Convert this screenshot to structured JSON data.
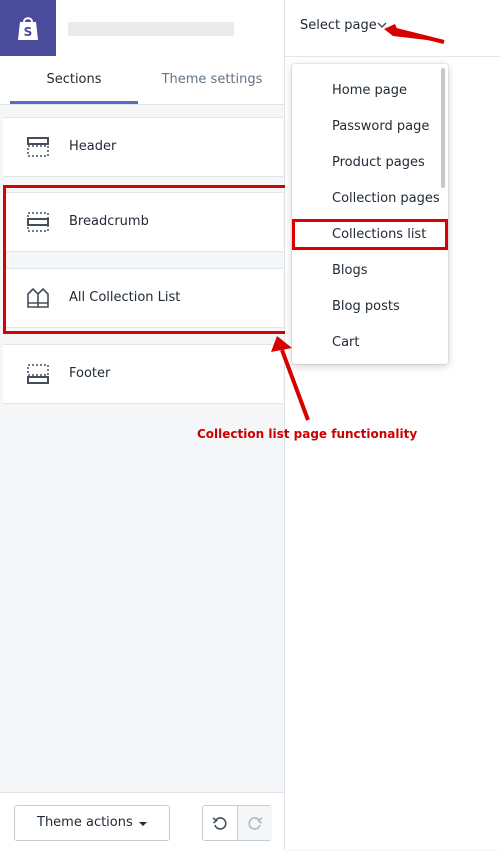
{
  "header": {
    "store_name": ""
  },
  "tabs": [
    {
      "label": "Sections"
    },
    {
      "label": "Theme settings"
    }
  ],
  "sections": [
    {
      "label": "Header",
      "icon": "header-layout-icon"
    },
    {
      "label": "Breadcrumb",
      "icon": "breadcrumb-layout-icon"
    },
    {
      "label": "All Collection List",
      "icon": "collection-list-icon"
    },
    {
      "label": "Footer",
      "icon": "footer-layout-icon"
    }
  ],
  "bottom": {
    "theme_actions_label": "Theme actions"
  },
  "preview": {
    "select_page_label": "Select page"
  },
  "dropdown": {
    "items": [
      {
        "label": "Home page"
      },
      {
        "label": "Password page"
      },
      {
        "label": "Product pages"
      },
      {
        "label": "Collection pages"
      },
      {
        "label": "Collections list"
      },
      {
        "label": "Blogs"
      },
      {
        "label": "Blog posts"
      },
      {
        "label": "Cart"
      }
    ],
    "highlighted": "Collections list"
  },
  "annotation": {
    "caption": "Collection list page functionality"
  },
  "colors": {
    "brand": "#4a4b9b",
    "tab_accent": "#5c6ac4",
    "annotation_red": "#d80000"
  }
}
